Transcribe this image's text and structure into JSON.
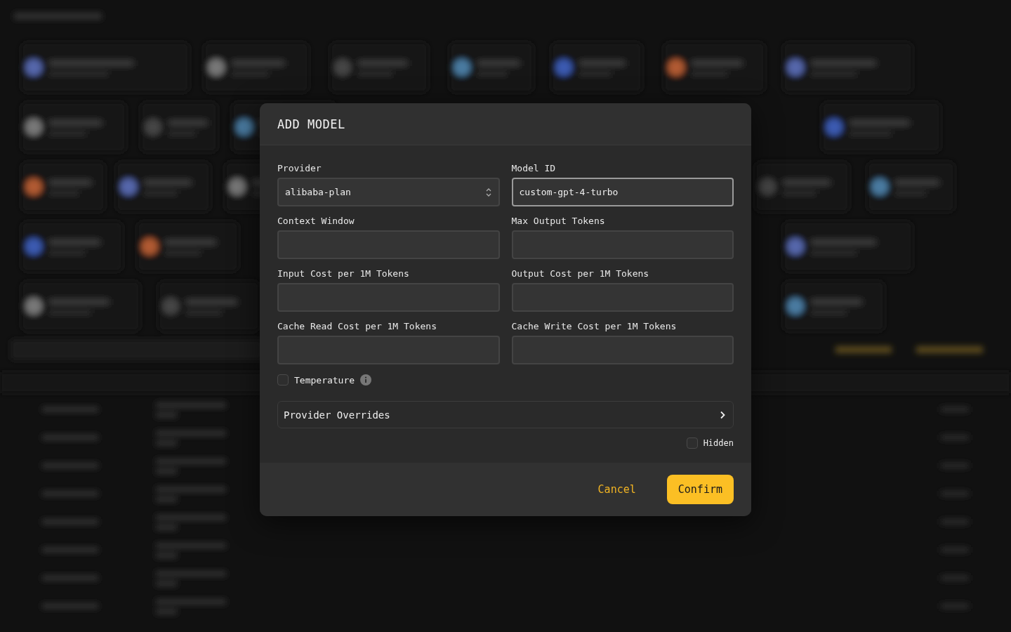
{
  "dialog": {
    "title": "ADD MODEL",
    "fields": [
      {
        "kind": "select",
        "label": "Provider",
        "value": "alibaba-plan",
        "focused": false
      },
      {
        "kind": "input",
        "label": "Model ID",
        "value": "custom-gpt-4-turbo",
        "focused": true
      },
      {
        "kind": "input",
        "label": "Context Window",
        "focused": false
      },
      {
        "kind": "input",
        "label": "Max Output Tokens",
        "focused": false
      },
      {
        "kind": "input",
        "label": "Input Cost per 1M Tokens",
        "focused": false
      },
      {
        "kind": "input",
        "label": "Output Cost per 1M Tokens",
        "focused": false
      },
      {
        "kind": "input",
        "label": "Cache Read Cost per 1M Tokens",
        "focused": false
      },
      {
        "kind": "input",
        "label": "Cache Write Cost per 1M Tokens",
        "focused": false
      }
    ],
    "temperature": {
      "label": "Temperature",
      "checked": false
    },
    "overrides": {
      "label": "Provider Overrides",
      "expanded": false
    },
    "hidden": {
      "label": "Hidden",
      "checked": false
    },
    "buttons": [
      {
        "kind": "text",
        "label": "Cancel"
      },
      {
        "kind": "primary",
        "label": "Confirm"
      }
    ]
  }
}
